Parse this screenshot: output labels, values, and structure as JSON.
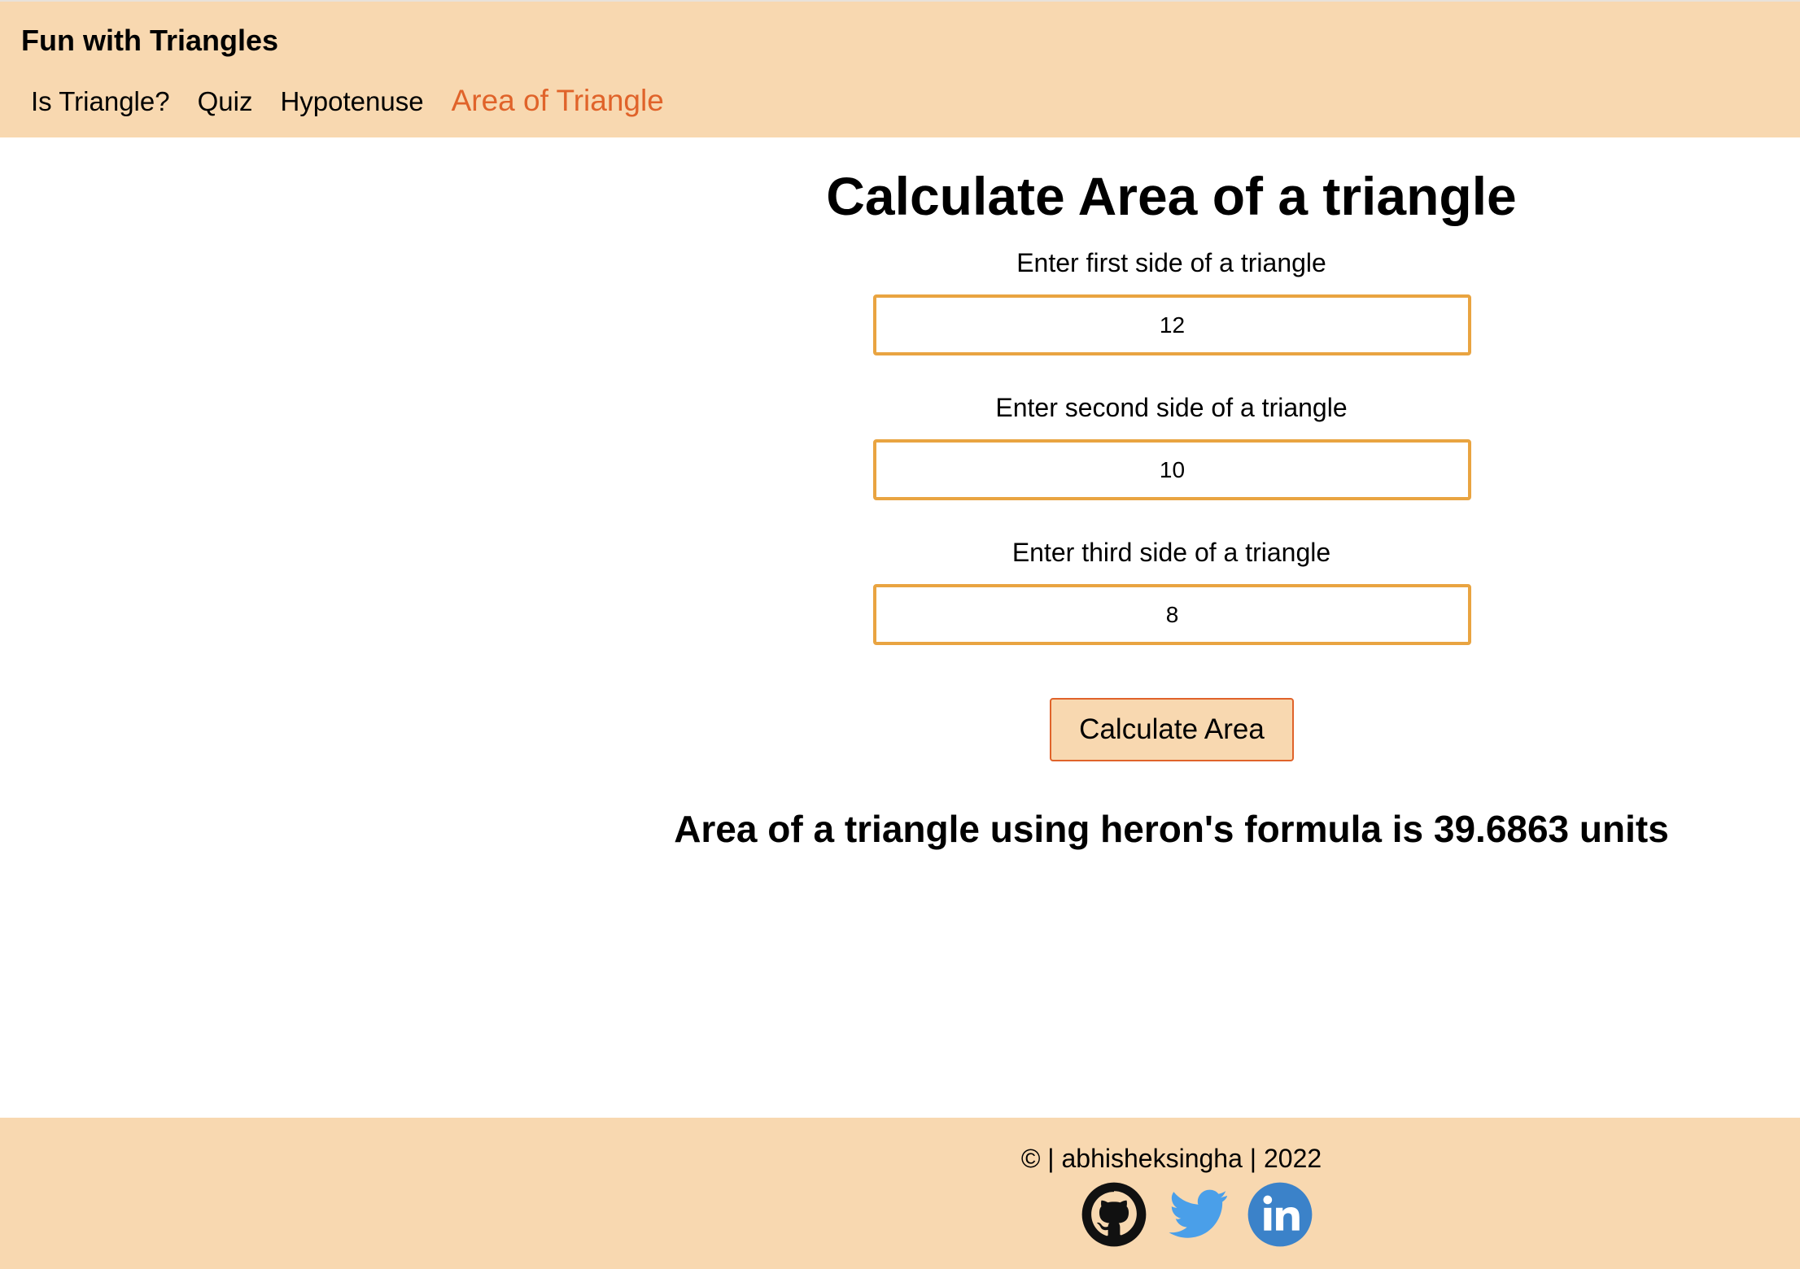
{
  "header": {
    "brand": "Fun with Triangles",
    "nav": [
      {
        "label": "Is Triangle?"
      },
      {
        "label": "Quiz"
      },
      {
        "label": "Hypotenuse"
      },
      {
        "label": "Area of Triangle",
        "active": true
      }
    ]
  },
  "main": {
    "title": "Calculate Area of a triangle",
    "fields": [
      {
        "label": "Enter first side of a triangle",
        "value": "12"
      },
      {
        "label": "Enter second side of a triangle",
        "value": "10"
      },
      {
        "label": "Enter third side of a triangle",
        "value": "8"
      }
    ],
    "button_label": "Calculate Area",
    "result": "Area of a triangle using heron's formula is 39.6863 units"
  },
  "footer": {
    "copyright": "© | abhisheksingha | 2022",
    "socials": [
      {
        "icon": "github-icon"
      },
      {
        "icon": "twitter-icon"
      },
      {
        "icon": "linkedin-icon"
      }
    ]
  },
  "colors": {
    "header_bg": "#f8d8b0",
    "accent": "#e0632a",
    "input_border": "#e9a441",
    "twitter": "#4a9fe9",
    "linkedin": "#3b82c9"
  }
}
